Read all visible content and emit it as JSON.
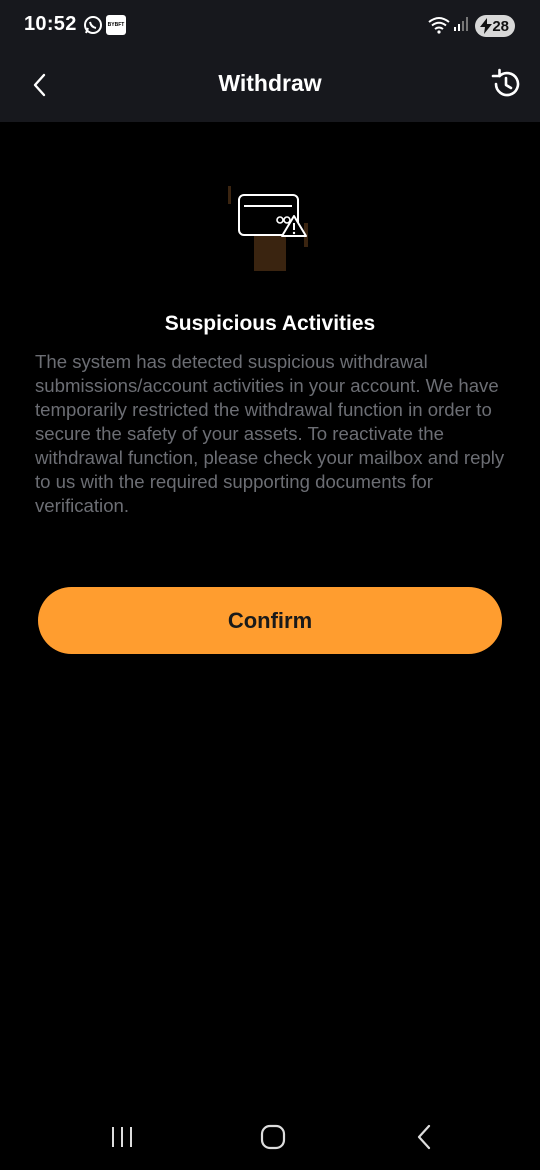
{
  "status_bar": {
    "time": "10:52",
    "app_badge_text": "BYBFT",
    "battery_level": "28"
  },
  "header": {
    "title": "Withdraw"
  },
  "alert": {
    "title": "Suspicious Activities",
    "body": "The system has detected suspicious withdrawal submissions/account activities in your account. We have temporarily restricted the withdrawal function in order to secure the safety of your assets. To reactivate the withdrawal function, please check your mailbox and reply to us with the required supporting documents for verification."
  },
  "confirm_label": "Confirm",
  "colors": {
    "accent": "#ff9d2f",
    "header_bg": "#17181d",
    "body_text": "#6c6e74"
  },
  "icons": {
    "back": "chevron-left-icon",
    "history": "history-icon",
    "illustration": "card-warning-icon",
    "nav_recents": "recents-icon",
    "nav_home": "home-icon",
    "nav_back": "nav-back-icon"
  }
}
